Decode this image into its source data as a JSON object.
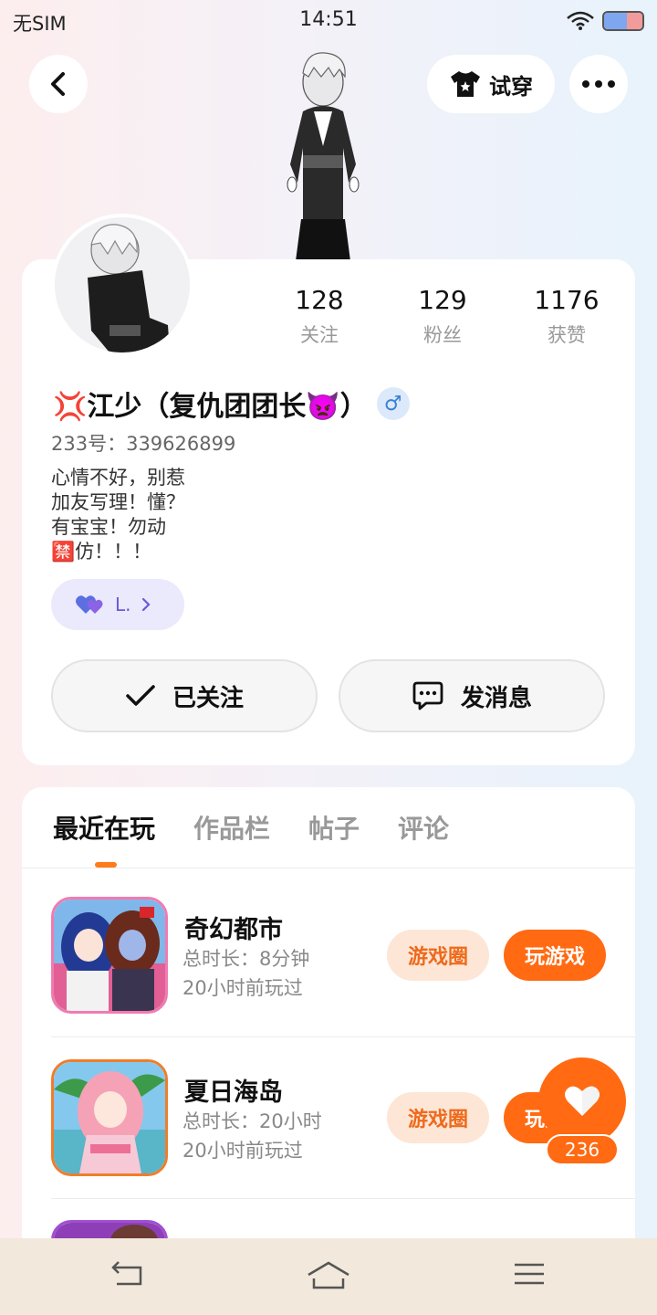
{
  "status_bar": {
    "carrier": "无SIM",
    "time": "14:51"
  },
  "header": {
    "try_on_label": "试穿"
  },
  "profile": {
    "stats": [
      {
        "value": "128",
        "label": "关注"
      },
      {
        "value": "129",
        "label": "粉丝"
      },
      {
        "value": "1176",
        "label": "获赞"
      }
    ],
    "username": "💢江少（复仇团团长👿）",
    "gender_symbol": "♂",
    "uid": "233号：339626899",
    "bio": "心情不好，别惹\n加友写理！懂？\n有宝宝！勿动\n🈲仿！！！",
    "badge_label": "L."
  },
  "actions": {
    "follow_label": "已关注",
    "message_label": "发消息"
  },
  "tabs": [
    {
      "label": "最近在玩",
      "active": true
    },
    {
      "label": "作品栏",
      "active": false
    },
    {
      "label": "帖子",
      "active": false
    },
    {
      "label": "评论",
      "active": false
    }
  ],
  "games": [
    {
      "name": "奇幻都市",
      "duration": "总时长：8分钟",
      "last_played": "20小时前玩过",
      "circle_label": "游戏圈",
      "play_label": "玩游戏"
    },
    {
      "name": "夏日海岛",
      "duration": "总时长：20小时",
      "last_played": "20小时前玩过",
      "circle_label": "游戏圈",
      "play_label": "玩游戏"
    }
  ],
  "like": {
    "count": "236"
  },
  "colors": {
    "accent": "#ff6a12",
    "accent_light": "#fde6d6",
    "badge_bg": "#ebe9fc",
    "gender": "#3b82d6"
  }
}
